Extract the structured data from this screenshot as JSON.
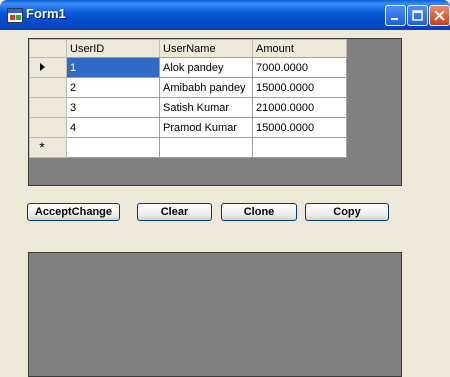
{
  "window": {
    "title": "Form1"
  },
  "grid": {
    "columns": [
      "UserID",
      "UserName",
      "Amount"
    ],
    "rows": [
      {
        "UserID": "1",
        "UserName": "Alok pandey",
        "Amount": "7000.0000"
      },
      {
        "UserID": "2",
        "UserName": "Amibabh pandey",
        "Amount": "15000.0000"
      },
      {
        "UserID": "3",
        "UserName": "Satish Kumar",
        "Amount": "21000.0000"
      },
      {
        "UserID": "4",
        "UserName": "Pramod Kumar",
        "Amount": "15000.0000"
      }
    ],
    "new_row_marker": "*"
  },
  "buttons": {
    "accept": "AcceptChange",
    "clear": "Clear",
    "clone": "Clone",
    "copy": "Copy"
  },
  "icons": {
    "app": "form-window-icon",
    "minimize": "minimize-icon",
    "maximize": "maximize-icon",
    "close": "close-icon",
    "current_row": "current-row-arrow-icon"
  },
  "colors": {
    "titlebar": "#0a56d8",
    "selection": "#316ac5",
    "grid_background": "#808080",
    "form_background": "#ece9d8"
  }
}
